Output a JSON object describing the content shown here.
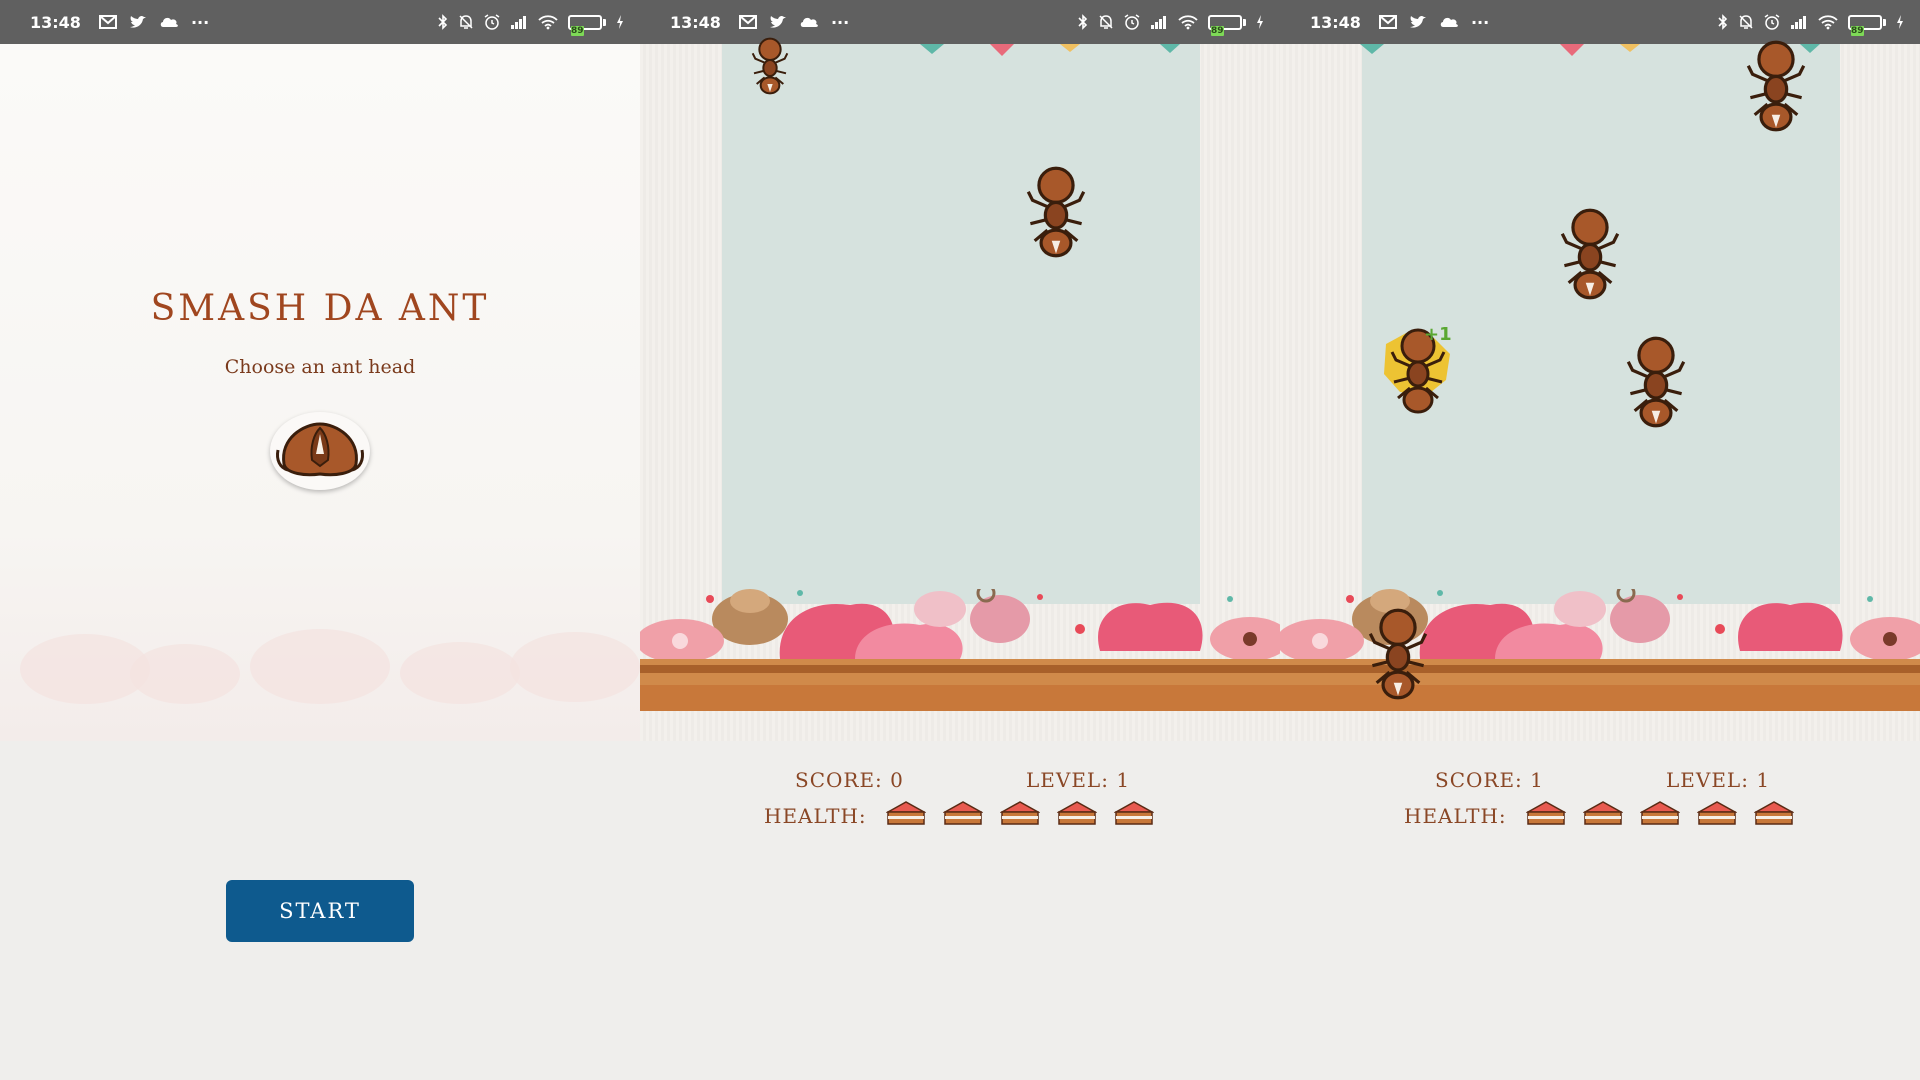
{
  "statusbar": {
    "time": "13:48",
    "battery": "89",
    "more": "···"
  },
  "start_screen": {
    "title": "SMASH DA ANT",
    "subtitle": "Choose an ant head",
    "start_label": "START"
  },
  "game_screens": [
    {
      "score_label": "SCORE:",
      "score": "0",
      "level_label": "LEVEL:",
      "level": "1",
      "health_label": "HEALTH:",
      "health": 5
    },
    {
      "score_label": "SCORE:",
      "score": "1",
      "level_label": "LEVEL:",
      "level": "1",
      "health_label": "HEALTH:",
      "health": 5,
      "popup": "+1"
    }
  ],
  "colors": {
    "accent": "#0e5a8e",
    "title": "#a0461f",
    "statusbar": "#606060",
    "lane": "#d6e2de"
  },
  "icons": [
    "gmail-icon",
    "twitter-icon",
    "cloud-icon",
    "bluetooth-icon",
    "mute-icon",
    "alarm-icon",
    "signal-icon",
    "wifi-icon",
    "battery-icon",
    "charging-icon",
    "ant-head-icon",
    "ant-icon",
    "cake-slice-icon"
  ]
}
